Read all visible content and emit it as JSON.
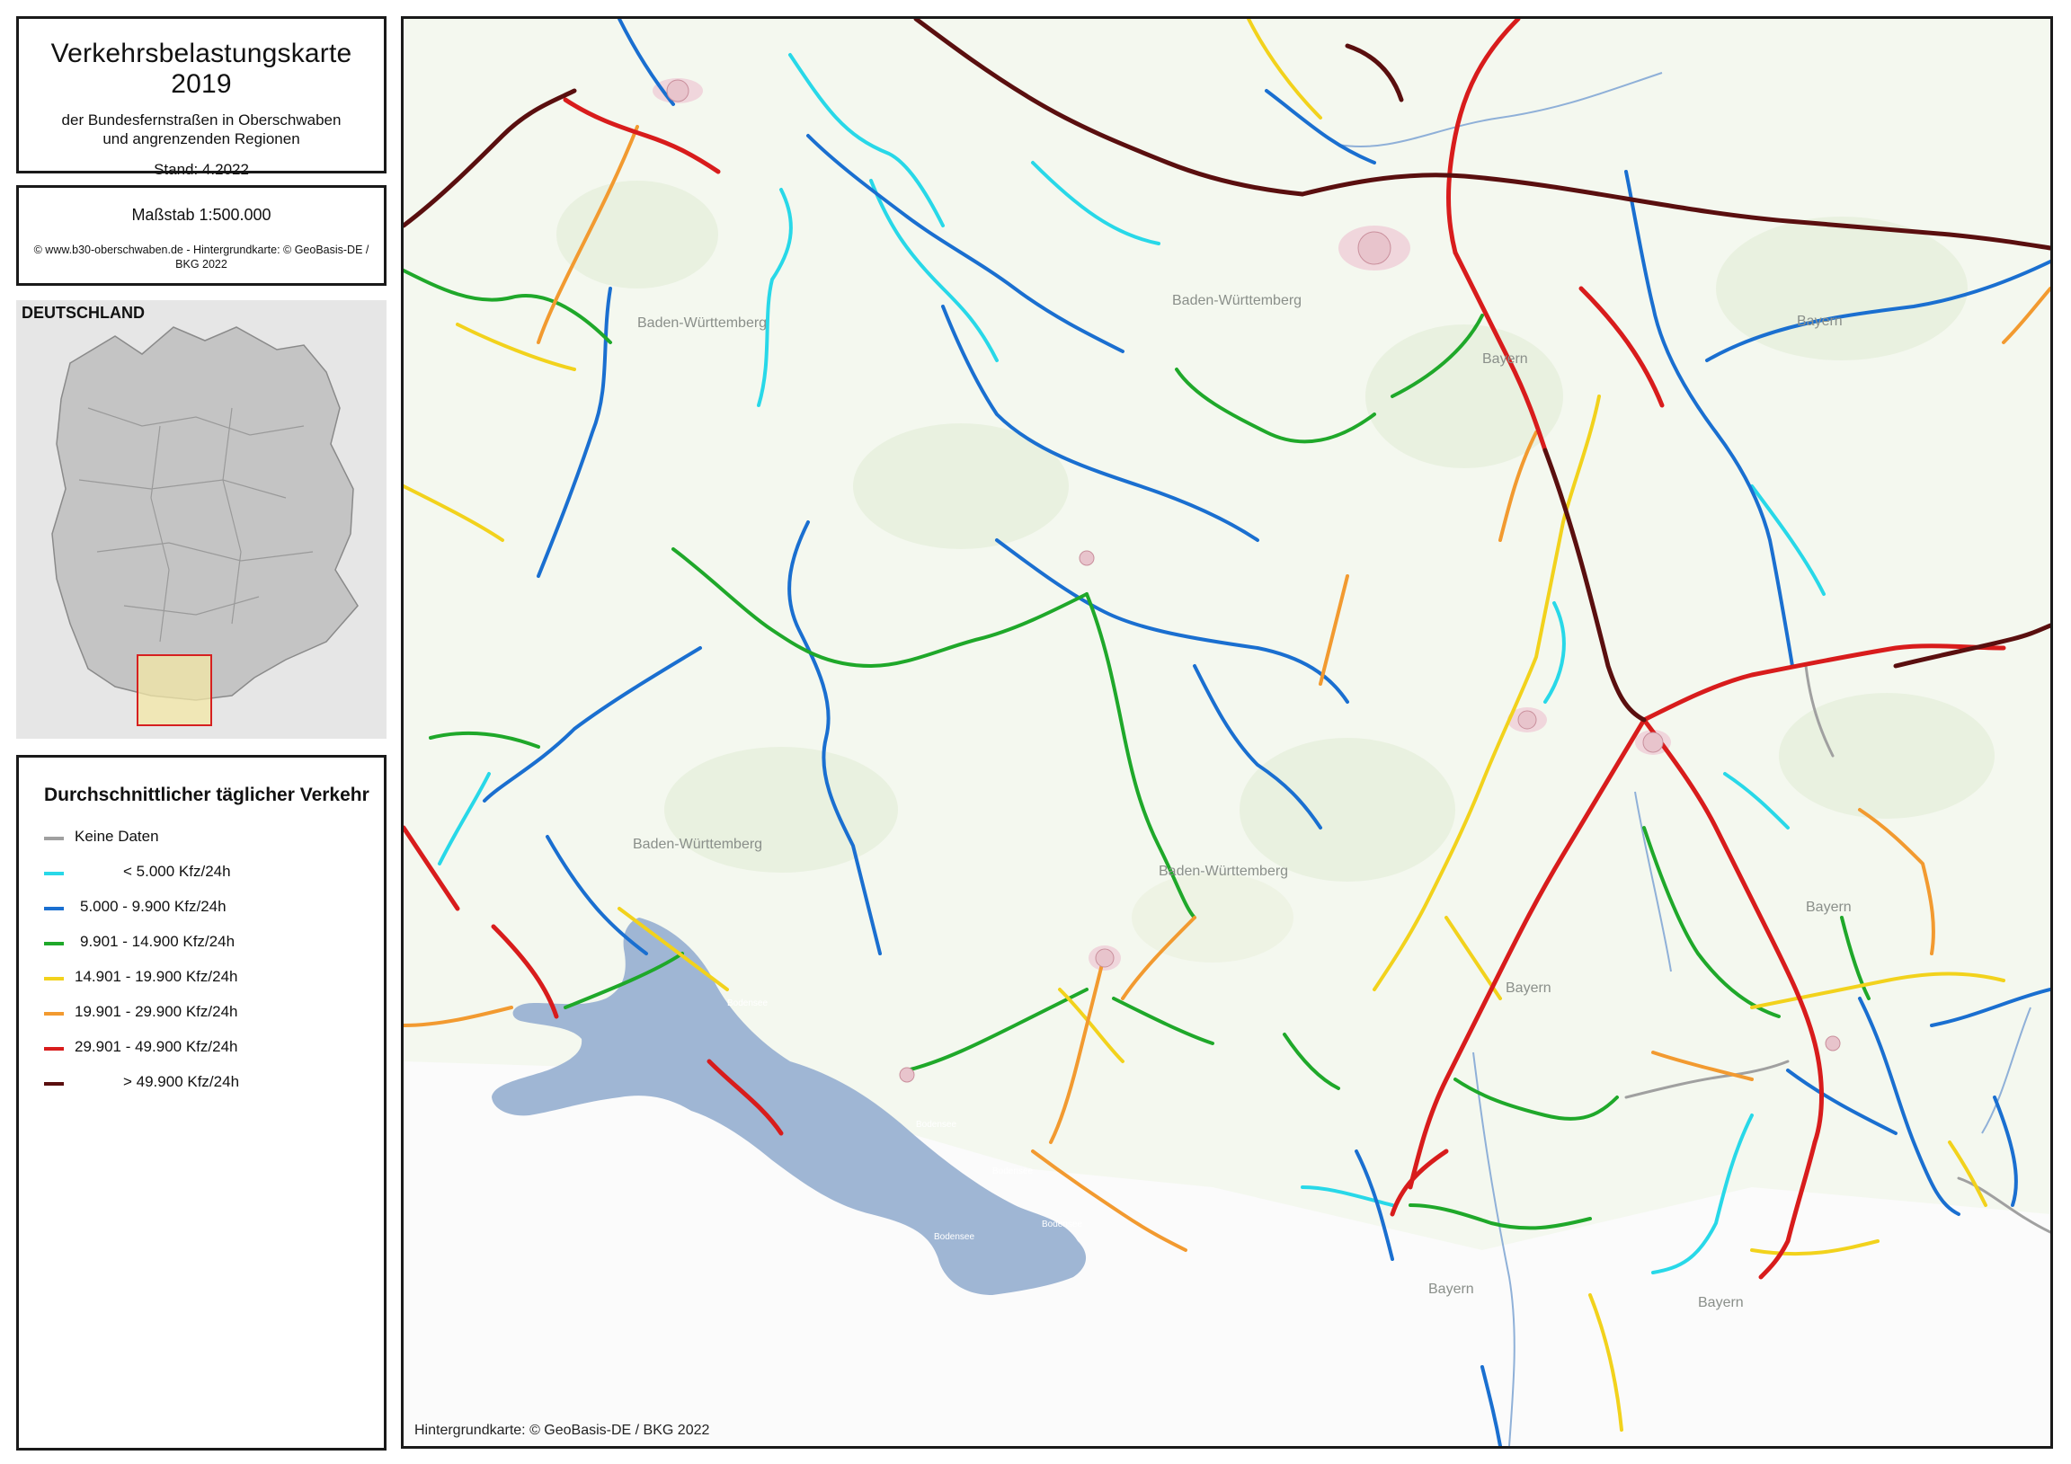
{
  "title": {
    "main": "Verkehrsbelastungskarte 2019",
    "sub1": "der Bundesfernstraßen in Oberschwaben",
    "sub2": "und angrenzenden Regionen",
    "stand": "Stand: 4.2022"
  },
  "scale": {
    "label": "Maßstab  1:500.000",
    "credit": "© www.b30-oberschwaben.de - Hintergrundkarte: © GeoBasis-DE / BKG 2022"
  },
  "inset": {
    "label": "DEUTSCHLAND",
    "highlight_color": "#d62020"
  },
  "legend": {
    "title": "Durchschnittlicher täglicher Verkehr",
    "items": [
      {
        "label": "Keine Daten",
        "color": "#a0a0a0"
      },
      {
        "label": "< 5.000 Kfz/24h",
        "color": "#28d8e8"
      },
      {
        "label": "5.000 -    9.900 Kfz/24h",
        "color": "#1a6fd0"
      },
      {
        "label": "9.901 - 14.900 Kfz/24h",
        "color": "#1fa82a"
      },
      {
        "label": "14.901 - 19.900 Kfz/24h",
        "color": "#f2d21c"
      },
      {
        "label": "19.901 - 29.900 Kfz/24h",
        "color": "#f29a30"
      },
      {
        "label": "29.901 - 49.900 Kfz/24h",
        "color": "#d81c1c"
      },
      {
        "label": "> 49.900 Kfz/24h",
        "color": "#5a0f0f"
      }
    ]
  },
  "map": {
    "attribution": "Hintergrundkarte: © GeoBasis-DE / BKG 2022",
    "regions": [
      "Baden-Württemberg",
      "Baden-Württemberg",
      "Baden-Württemberg",
      "Bayern",
      "Bayern",
      "Bayern",
      "Bayern",
      "Bayern",
      "Bayern",
      "Baden-Württemberg"
    ],
    "lake_labels": [
      "Bodensee",
      "Bodensee",
      "Bodensee",
      "Bodensee",
      "Bodensee"
    ],
    "water_color": "#9fb6d4"
  }
}
